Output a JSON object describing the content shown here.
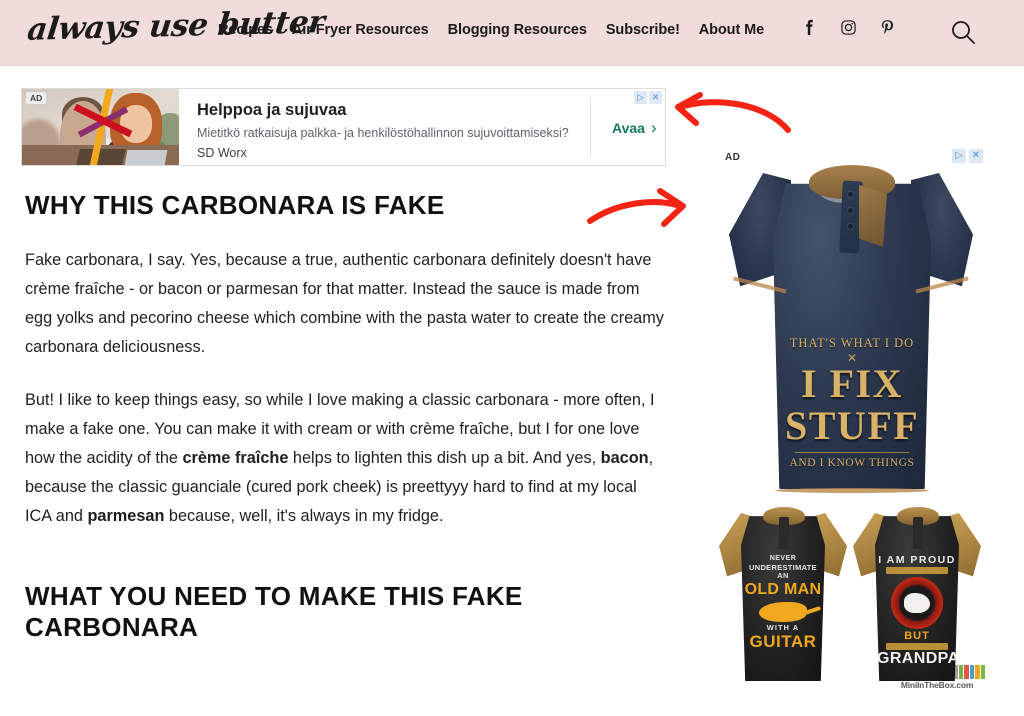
{
  "header": {
    "logo": "always use butter",
    "nav": [
      {
        "label": "Recipes"
      },
      {
        "label": "Air Fryer Resources"
      },
      {
        "label": "Blogging Resources"
      },
      {
        "label": "Subscribe!"
      },
      {
        "label": "About Me"
      }
    ],
    "social": [
      {
        "name": "facebook-icon",
        "glyph": "f"
      },
      {
        "name": "instagram-icon",
        "glyph": "▢"
      },
      {
        "name": "pinterest-icon",
        "glyph": "P"
      }
    ],
    "search_label": "Search",
    "background_color": "#EFDCDB"
  },
  "top_ad": {
    "badge": "AD",
    "title": "Helppoa ja sujuvaa",
    "description": "Mietitkö ratkaisuja palkka- ja henkilöstöhallinnon sujuvoittamiseksi?",
    "brand": "SD Worx",
    "cta": "Avaa",
    "cta_chevron": "›",
    "adchoices_triangle": "▷",
    "adchoices_close": "✕",
    "cta_color": "#137a5e"
  },
  "article": {
    "heading_1": "Why This Carbonara Is Fake",
    "paragraph_1": "Fake carbonara, I say. Yes, because a true, authentic carbonara definitely doesn't have crème fraîche - or bacon or parmesan for that matter. Instead the sauce is made from egg yolks and pecorino cheese which combine with the pasta water to create the creamy carbonara deliciousness.",
    "paragraph_2_part1": "But! I like to keep things easy, so while I love making a classic carbonara - more often, I make a fake one. You can make it with cream or with crème fraîche, but I for one love how the acidity of the ",
    "paragraph_2_bold1": "crème fraîche",
    "paragraph_2_part2": " helps to lighten this dish up a bit. And yes, ",
    "paragraph_2_bold2": "bacon",
    "paragraph_2_part3": ", because the classic guanciale (cured pork cheek) is preettyyy hard to find at my local ICA and ",
    "paragraph_2_bold3": "parmesan",
    "paragraph_2_part4": " because, well, it's always in my fridge.",
    "heading_2": "What You Need To Make This Fake Carbonara"
  },
  "annotations": {
    "arrow_1": "red-curved-arrow-pointing-left",
    "arrow_2": "red-curved-arrow-pointing-right",
    "color": "#F42314"
  },
  "side_ad": {
    "badge": "AD",
    "adchoices_triangle": "▷",
    "adchoices_close": "✕",
    "main_shirt": {
      "line1": "THAT'S    WHAT I DO",
      "x_mark": "✕",
      "line2": "I FIX",
      "line3": "STUFF",
      "line4": "AND I KNOW THINGS",
      "shirt_color": "#2c3950",
      "text_color": "#D9B268"
    },
    "watermark": "MiniInTheBox.com",
    "thumb_shirt_1": {
      "line1": "NEVER",
      "line2": "UNDERESTIMATE AN",
      "line3": "OLD MAN",
      "line4": "WITH A",
      "line5": "GUITAR",
      "accent_color": "#F0A81E"
    },
    "thumb_shirt_2": {
      "line1": "I AM  PROUD",
      "line2": "BUT",
      "line3": "GRANDPA",
      "accent_color": "#F0A81E"
    }
  }
}
